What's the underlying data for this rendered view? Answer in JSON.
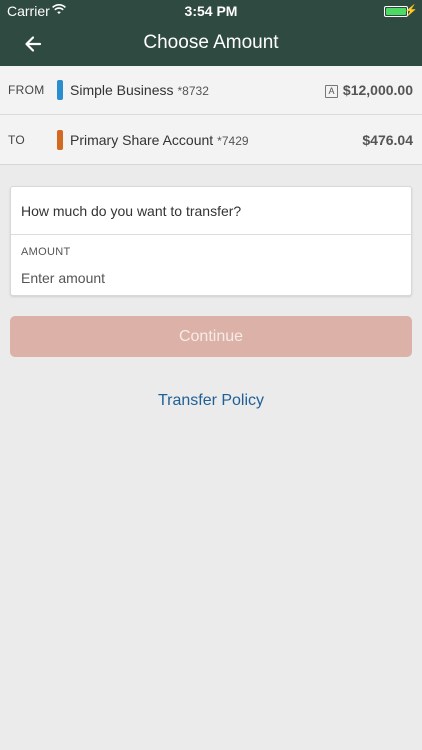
{
  "status_bar": {
    "carrier": "Carrier",
    "time": "3:54 PM"
  },
  "nav": {
    "title": "Choose Amount"
  },
  "transfer": {
    "from": {
      "label": "FROM",
      "account_name": "Simple Business",
      "account_number": "*8732",
      "badge": "A",
      "balance": "$12,000.00",
      "color": "#2a8dd0"
    },
    "to": {
      "label": "TO",
      "account_name": "Primary Share Account",
      "account_number": "*7429",
      "balance": "$476.04",
      "color": "#d2691e"
    }
  },
  "amount_card": {
    "question": "How much do you want to transfer?",
    "amount_label": "AMOUNT",
    "amount_placeholder": "Enter amount",
    "amount_value": ""
  },
  "actions": {
    "continue_label": "Continue",
    "transfer_policy_label": "Transfer Policy"
  },
  "colors": {
    "header_bg": "#2f4a41",
    "continue_disabled_bg": "#dcb2a8",
    "link": "#1f5f96",
    "battery": "#4cd964"
  }
}
